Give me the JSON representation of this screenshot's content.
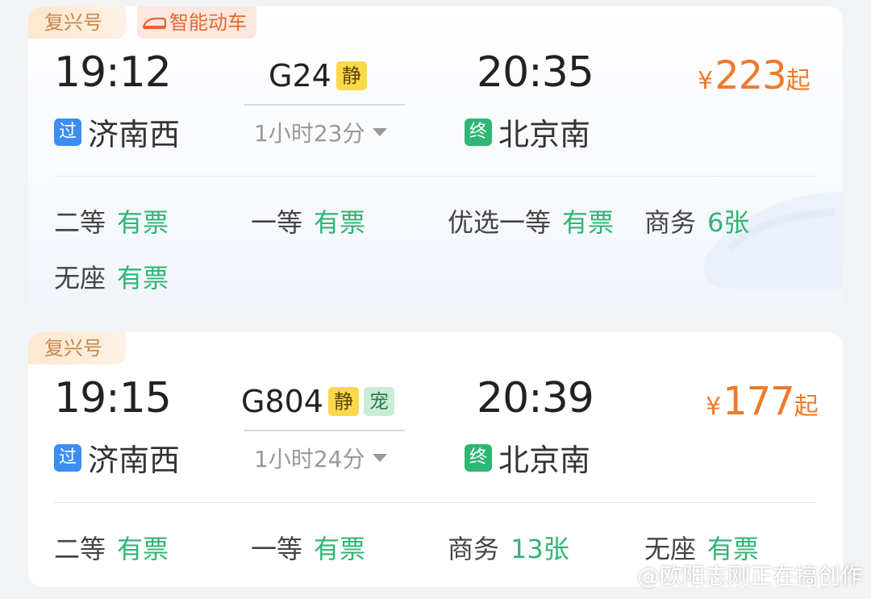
{
  "trains": [
    {
      "type_tag": "复兴号",
      "feature_tag": "智能动车",
      "departure_time": "19:12",
      "departure_station": "济南西",
      "departure_badge": "过",
      "train_no": "G24",
      "badges": [
        "静"
      ],
      "duration": "1小时23分",
      "arrival_time": "20:35",
      "arrival_station": "北京南",
      "arrival_badge": "终",
      "price_symbol": "¥",
      "price": "223",
      "price_suffix": "起",
      "seats": [
        {
          "class": "二等",
          "status": "有票"
        },
        {
          "class": "一等",
          "status": "有票"
        },
        {
          "class": "优选一等",
          "status": "有票"
        },
        {
          "class": "商务",
          "status": "6张"
        },
        {
          "class": "无座",
          "status": "有票"
        }
      ]
    },
    {
      "type_tag": "复兴号",
      "departure_time": "19:15",
      "departure_station": "济南西",
      "departure_badge": "过",
      "train_no": "G804",
      "badges": [
        "静",
        "宠"
      ],
      "duration": "1小时24分",
      "arrival_time": "20:39",
      "arrival_station": "北京南",
      "arrival_badge": "终",
      "price_symbol": "¥",
      "price": "177",
      "price_suffix": "起",
      "seats": [
        {
          "class": "二等",
          "status": "有票"
        },
        {
          "class": "一等",
          "status": "有票"
        },
        {
          "class": "商务",
          "status": "13张"
        },
        {
          "class": "无座",
          "status": "有票"
        }
      ]
    }
  ],
  "watermark": "@欧阳志刚正在搞创作",
  "colors": {
    "price": "#f07a2a",
    "available": "#2fb574",
    "pass_badge": "#3b8ff2",
    "end_badge": "#2fb574",
    "quiet_badge": "#fbd84a",
    "pet_badge": "#c8ecd7"
  },
  "icons": {
    "feature_tag": "train-icon",
    "watermark": "weibo-icon"
  }
}
